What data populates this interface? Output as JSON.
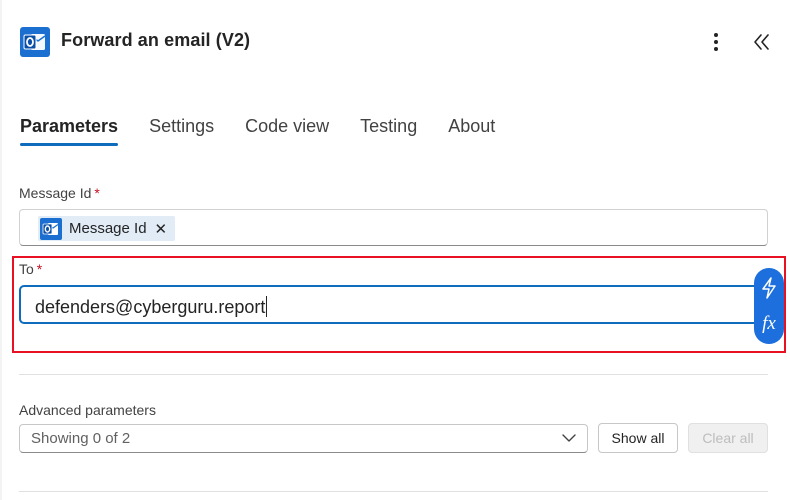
{
  "header": {
    "title": "Forward an email (V2)",
    "app_icon": "outlook-icon",
    "more_icon": "more-vertical-icon",
    "collapse_icon": "chevron-double-left-icon"
  },
  "tabs": [
    {
      "label": "Parameters",
      "active": true
    },
    {
      "label": "Settings",
      "active": false
    },
    {
      "label": "Code view",
      "active": false
    },
    {
      "label": "Testing",
      "active": false
    },
    {
      "label": "About",
      "active": false
    }
  ],
  "fields": {
    "message_id": {
      "label": "Message Id",
      "required_mark": "*",
      "token_label": "Message Id",
      "token_icon": "outlook-icon",
      "token_remove": "✕"
    },
    "to": {
      "label": "To",
      "required_mark": "*",
      "value": "defenders@cyberguru.report"
    }
  },
  "side_actions": {
    "dynamic_content_icon": "lightning-icon",
    "expression_icon": "fx-icon",
    "expression_label": "fx"
  },
  "advanced": {
    "label": "Advanced parameters",
    "select_value": "Showing 0 of 2",
    "show_all_label": "Show all",
    "clear_all_label": "Clear all"
  },
  "colors": {
    "accent": "#0f6cbd",
    "highlight_border": "#e81123",
    "required": "#c50f1f",
    "side_button": "#1c6fdc"
  }
}
